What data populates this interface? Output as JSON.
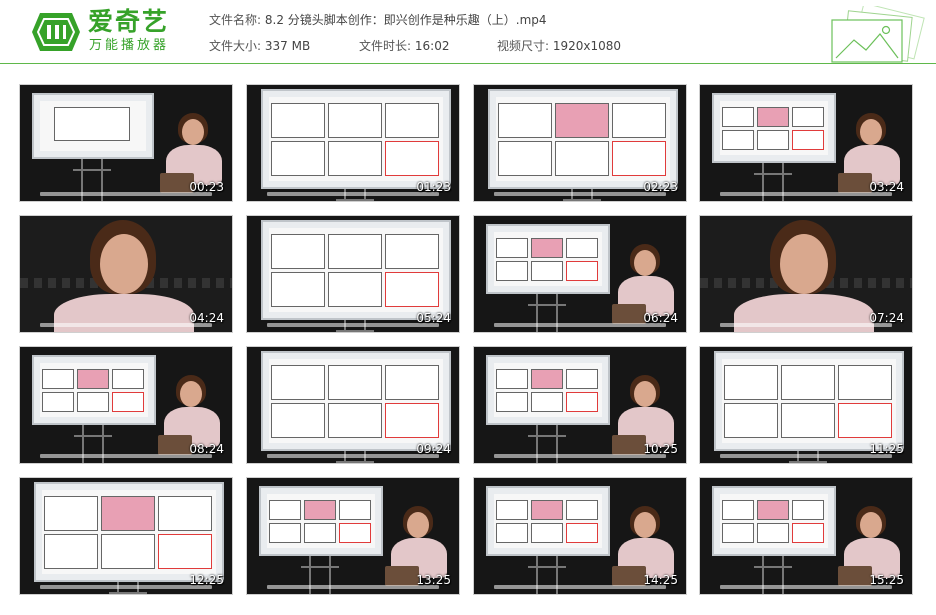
{
  "app": {
    "logo_text": "爱奇艺",
    "logo_sub": "万能播放器",
    "logo_color": "#36a229"
  },
  "file_info": {
    "name_label": "文件名称:",
    "name_value": "8.2 分镜头脚本创作：即兴创作是种乐趣（上）.mp4",
    "size_label": "文件大小:",
    "size_value": "337 MB",
    "duration_label": "文件时长:",
    "duration_value": "16:02",
    "resolution_label": "视频尺寸:",
    "resolution_value": "1920x1080"
  },
  "thumbnails": [
    {
      "time": "00:23",
      "kind": "title"
    },
    {
      "time": "01:23",
      "kind": "board"
    },
    {
      "time": "02:23",
      "kind": "board"
    },
    {
      "time": "03:24",
      "kind": "side"
    },
    {
      "time": "04:24",
      "kind": "closeup"
    },
    {
      "time": "05:24",
      "kind": "board"
    },
    {
      "time": "06:24",
      "kind": "side"
    },
    {
      "time": "07:24",
      "kind": "closeup"
    },
    {
      "time": "08:24",
      "kind": "side"
    },
    {
      "time": "09:24",
      "kind": "board"
    },
    {
      "time": "10:25",
      "kind": "side"
    },
    {
      "time": "11:25",
      "kind": "board"
    },
    {
      "time": "12:25",
      "kind": "board"
    },
    {
      "time": "13:25",
      "kind": "side"
    },
    {
      "time": "14:25",
      "kind": "side"
    },
    {
      "time": "15:25",
      "kind": "side"
    }
  ]
}
